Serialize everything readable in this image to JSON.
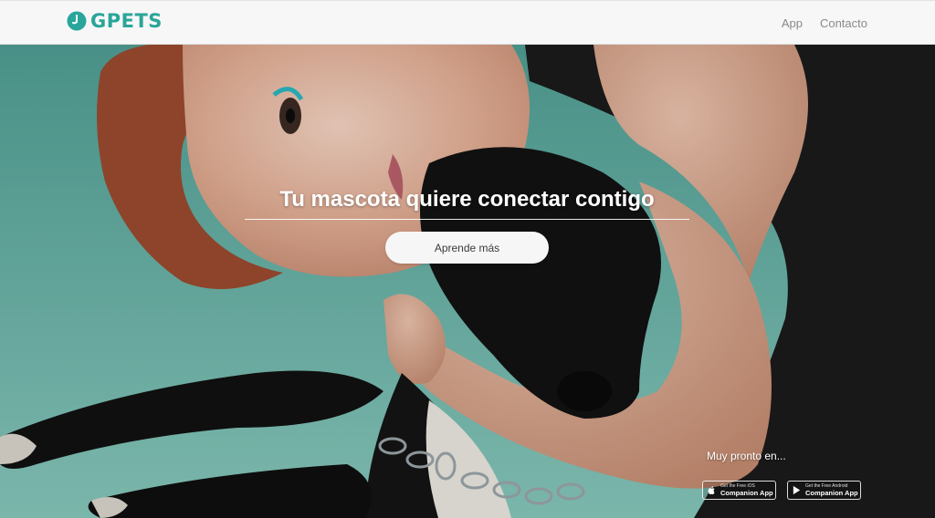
{
  "navbar": {
    "brand": "GPETS",
    "links": [
      "App",
      "Contacto"
    ]
  },
  "hero": {
    "headline": "Tu mascota quiere conectar contigo",
    "cta_label": "Aprende más",
    "soon_text": "Muy pronto en...",
    "badges": {
      "ios": {
        "small": "Get the Free iOS",
        "big": "Companion App"
      },
      "android": {
        "small": "Get the Free Android",
        "big": "Companion App"
      }
    }
  },
  "colors": {
    "brand": "#2aa59a",
    "navbar_bg": "#f7f7f7",
    "nav_link": "#8a8a8a",
    "hero_background": "#6fb0a8",
    "button_bg": "#f6f6f6"
  },
  "icons": [
    "logo-icon",
    "apple-icon",
    "google-play-icon"
  ]
}
